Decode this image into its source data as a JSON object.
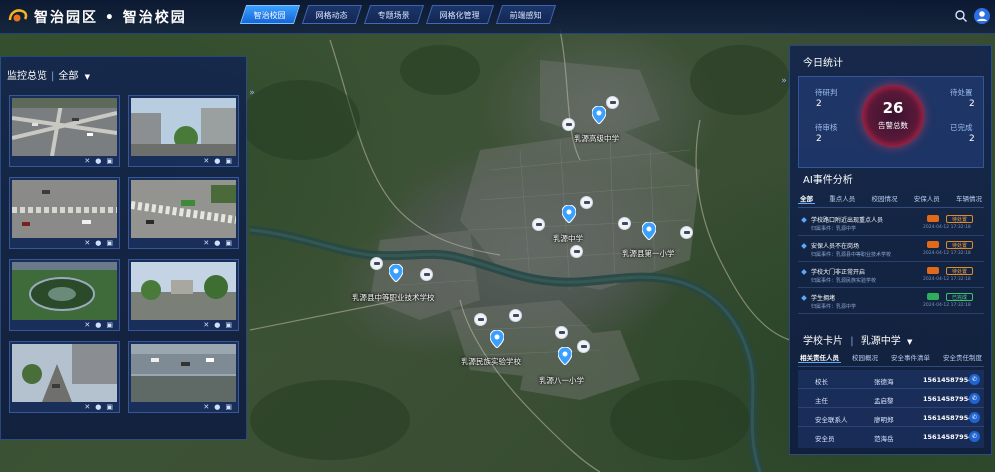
{
  "header": {
    "title": "智治园区 • 智治校园",
    "tabs": [
      "智治校园",
      "网格动态",
      "专题场景",
      "网格化管理",
      "前端感知"
    ],
    "active_tab": 0
  },
  "left": {
    "title": "监控总览",
    "filter": "全部"
  },
  "map": {
    "schools": [
      "乳源高级中学",
      "乳源中学",
      "乳源县第一小学",
      "乳源县中等职业技术学校",
      "乳源民族实验学校",
      "乳源八一小学"
    ]
  },
  "right": {
    "stats_title": "今日统计",
    "stats": {
      "pending_review": {
        "label": "待研判",
        "value": "2"
      },
      "pending_handle": {
        "label": "待处置",
        "value": "2"
      },
      "pending_check": {
        "label": "待审核",
        "value": "2"
      },
      "completed": {
        "label": "已完成",
        "value": "2"
      },
      "total": {
        "value": "26",
        "label": "告警总数"
      }
    },
    "ai_title": "AI事件分析",
    "ai_tabs": [
      "全部",
      "重点人员",
      "校园情况",
      "安保人员",
      "车辆情况"
    ],
    "events": [
      {
        "title": "学校路口附近出现重点人员",
        "sub": "归属事件：乳源中学",
        "time": "2024-04-12 17:32:18",
        "status": "待处置",
        "state": "pending"
      },
      {
        "title": "安保人员不在岗场",
        "sub": "归属事件：乳源县中等职业技术学校",
        "time": "2024-04-12 17:32:18",
        "status": "待处置",
        "state": "pending"
      },
      {
        "title": "学校大门非正常开启",
        "sub": "归属事件：乳源民族实验学校",
        "time": "2024-04-12 17:32:18",
        "status": "待处置",
        "state": "pending"
      },
      {
        "title": "学生拥堵",
        "sub": "归属事件：乳源中学",
        "time": "2024-04-12 17:32:18",
        "status": "已完成",
        "state": "done"
      }
    ],
    "card_title": "学校卡片",
    "card_school": "乳源中学",
    "card_tabs": [
      "相关责任人员",
      "校园概况",
      "安全事件清单",
      "安全责任制度"
    ],
    "contacts": [
      {
        "role": "校长",
        "name": "张德海",
        "phone": "15614587954"
      },
      {
        "role": "主任",
        "name": "孟启黎",
        "phone": "15614587954"
      },
      {
        "role": "安全联系人",
        "name": "廖明郑",
        "phone": "15614587954"
      },
      {
        "role": "安全员",
        "name": "范海岳",
        "phone": "15614587954"
      }
    ]
  },
  "colors": {
    "accent": "#3aa0ff",
    "alarm": "#e23050",
    "done": "#3cc070",
    "pending": "#e08a2a"
  }
}
